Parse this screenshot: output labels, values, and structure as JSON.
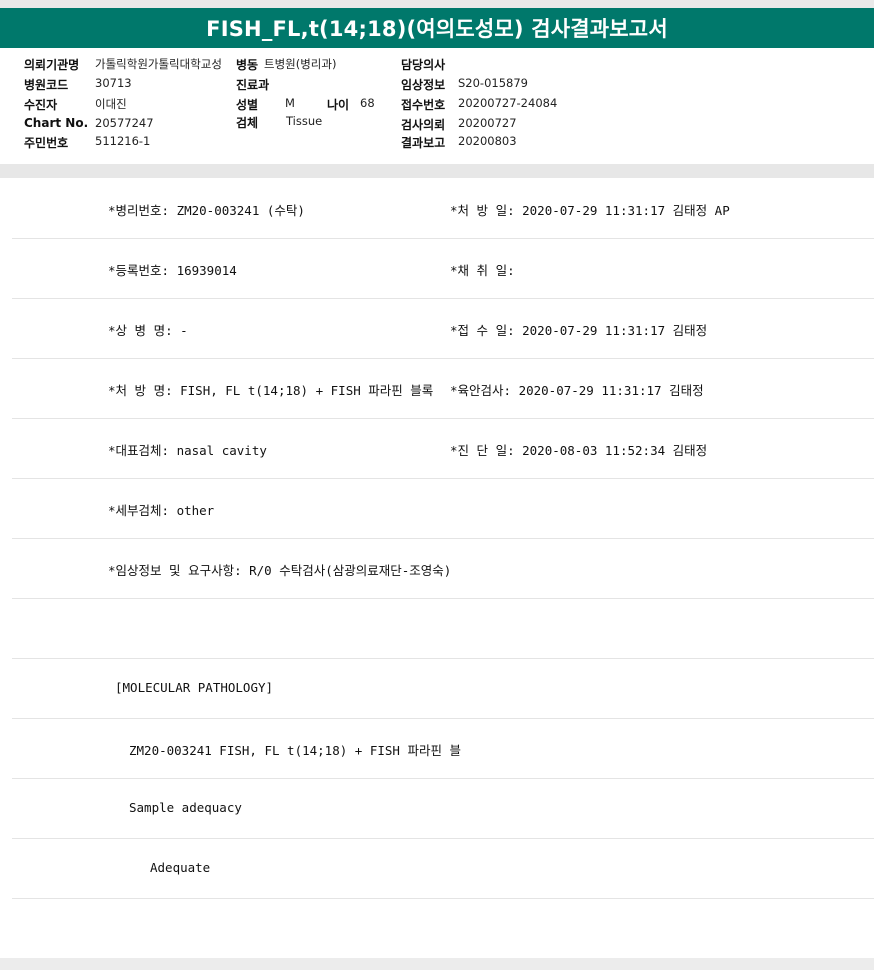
{
  "title": "FISH_FL,t(14;18)(여의도성모) 검사결과보고서",
  "header": {
    "institution_label": "의뢰기관명",
    "institution_value": "가톨릭학원가톨릭대학교성",
    "ward_label": "병동",
    "ward_value": "트병원(병리과)",
    "doctor_label": "담당의사",
    "doctor_value": "",
    "hospital_code_label": "병원코드",
    "hospital_code_value": "30713",
    "dept_label": "진료과",
    "dept_value": "",
    "clinical_label": "임상정보",
    "clinical_value": "S20-015879",
    "examinee_label": "수진자",
    "examinee_value": "이대진",
    "sex_label": "성별",
    "sex_value": "M",
    "age_label": "나이",
    "age_value": "68",
    "receipt_label": "접수번호",
    "receipt_value": "20200727-24084",
    "chart_label": "Chart No.",
    "chart_value": "20577247",
    "specimen_label": "검체",
    "specimen_value": "Tissue",
    "request_label": "검사의뢰",
    "request_value": "20200727",
    "rrn_label": "주민번호",
    "rrn_value": "511216-1",
    "result_label": "결과보고",
    "result_value": "20200803"
  },
  "report": {
    "rows": [
      {
        "left": "*병리번호: ZM20-003241 (수탁)",
        "right": "*처 방 일: 2020-07-29 11:31:17  김태정 AP"
      },
      {
        "left": "*등록번호: 16939014",
        "right": "*채 취 일:"
      },
      {
        "left": "*상 병 명: -",
        "right": "*접 수 일: 2020-07-29 11:31:17  김태정"
      },
      {
        "left": "*처 방 명: FISH, FL t(14;18) + FISH 파라핀 블록",
        "right": "*육안검사: 2020-07-29 11:31:17  김태정"
      },
      {
        "left": "*대표검체: nasal cavity",
        "right": "*진 단 일: 2020-08-03 11:52:34  김태정"
      },
      {
        "left": "*세부검체: other",
        "right": ""
      },
      {
        "left": "*임상정보 및 요구사항: R/0 수탁검사(삼광의료재단-조영숙)",
        "right": ""
      },
      {
        "left": "",
        "right": ""
      },
      {
        "left": "[MOLECULAR PATHOLOGY]",
        "right": ""
      },
      {
        "left": "ZM20-003241     FISH, FL t(14;18) + FISH 파라핀 블",
        "right": ""
      },
      {
        "left": "Sample adequacy",
        "right": ""
      },
      {
        "left": "Adequate",
        "right": ""
      },
      {
        "left": "",
        "right": ""
      }
    ]
  }
}
